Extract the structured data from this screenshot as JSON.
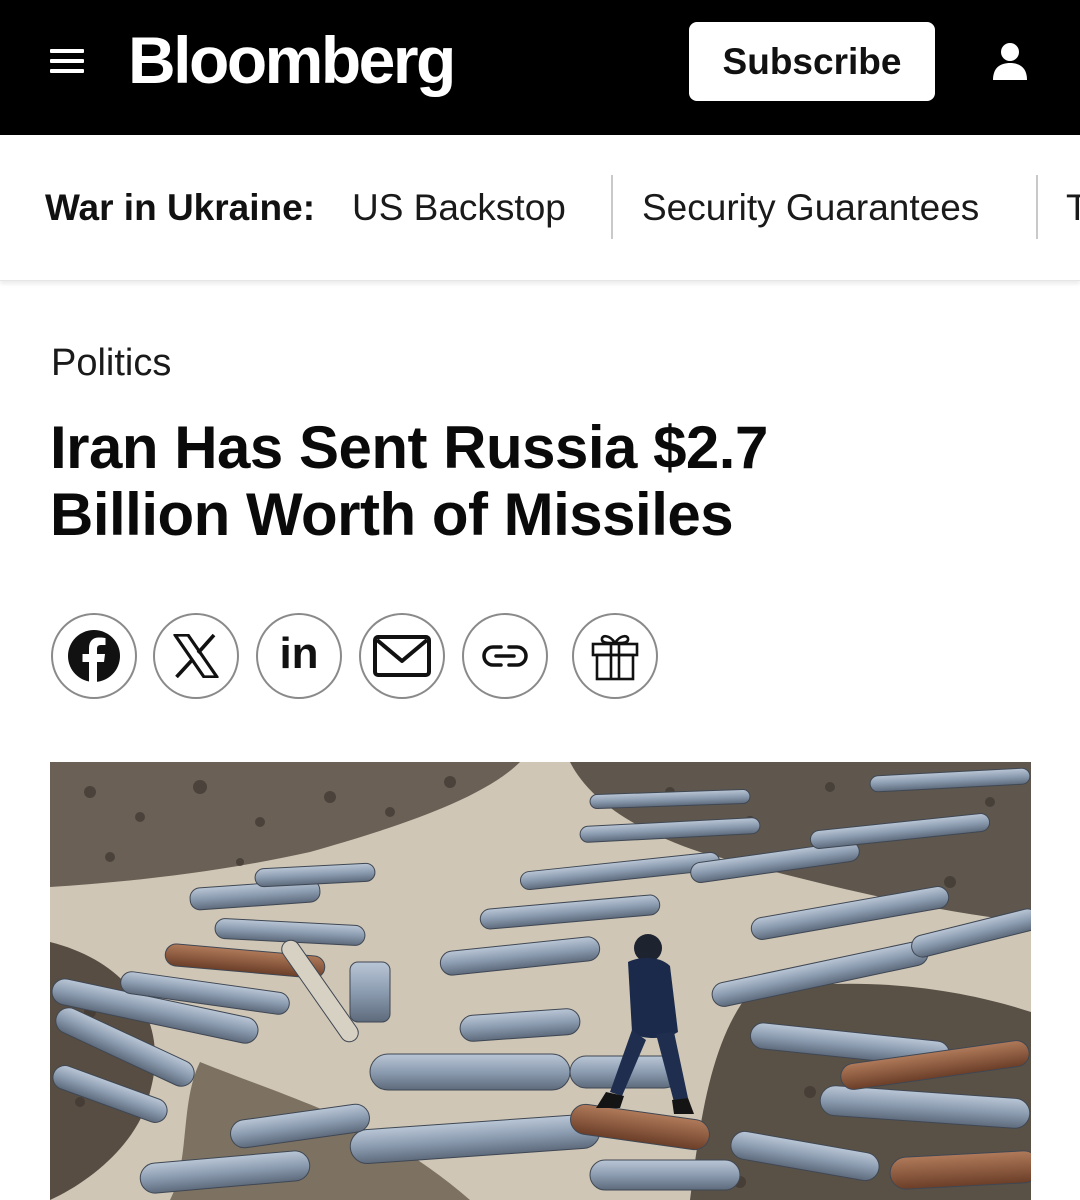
{
  "header": {
    "logo": "Bloomberg",
    "subscribe_label": "Subscribe",
    "menu_icon": "hamburger-menu-icon",
    "account_icon": "user-account-icon",
    "background_color": "#000000"
  },
  "topic_nav": {
    "label": "War in Ukraine:",
    "links": [
      "US Backstop",
      "Security Guarantees",
      "T"
    ]
  },
  "article": {
    "category": "Politics",
    "headline": "Iran Has Sent Russia $2.7 Billion Worth of Missiles",
    "share_icons": [
      "facebook-icon",
      "x-icon",
      "linkedin-icon",
      "email-icon",
      "link-icon",
      "gift-icon"
    ],
    "linkedin_text": "in",
    "hero_image": "photo-of-missile-debris-field"
  }
}
